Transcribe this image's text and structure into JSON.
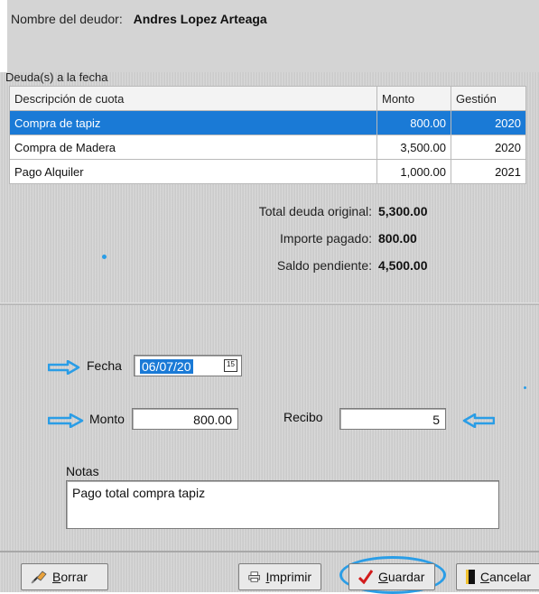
{
  "debtor": {
    "label": "Nombre del deudor:",
    "name": "Andres Lopez Arteaga"
  },
  "debts": {
    "title": "Deuda(s) a la fecha",
    "columns": [
      "Descripción de cuota",
      "Monto",
      "Gestión"
    ],
    "rows": [
      {
        "descripcion": "Compra de tapiz",
        "monto": "800.00",
        "gestion": "2020",
        "selected": true
      },
      {
        "descripcion": "Compra de Madera",
        "monto": "3,500.00",
        "gestion": "2020",
        "selected": false
      },
      {
        "descripcion": "Pago Alquiler",
        "monto": "1,000.00",
        "gestion": "2021",
        "selected": false
      }
    ]
  },
  "totals": {
    "original_label": "Total deuda original:",
    "original_value": "5,300.00",
    "pagado_label": "Importe pagado:",
    "pagado_value": "800.00",
    "saldo_label": "Saldo pendiente:",
    "saldo_value": "4,500.00"
  },
  "form": {
    "fecha_label": "Fecha",
    "fecha_value": "06/07/20",
    "calendar_glyph": "15",
    "monto_label": "Monto",
    "monto_value": "800.00",
    "recibo_label": "Recibo",
    "recibo_value": "5",
    "notas_label": "Notas",
    "notas_value": "Pago total compra tapiz"
  },
  "buttons": {
    "borrar": "Borrar",
    "imprimir": "Imprimir",
    "guardar": "Guardar",
    "cancelar": "Cancelar"
  },
  "colors": {
    "selection": "#1a7ad6",
    "annotation": "#2a9de6",
    "check": "#d21b1b"
  },
  "icons": [
    "eraser-icon",
    "printer-icon",
    "checkmark-icon",
    "door-icon",
    "calendar-icon",
    "arrow-right-icon",
    "arrow-left-icon"
  ]
}
